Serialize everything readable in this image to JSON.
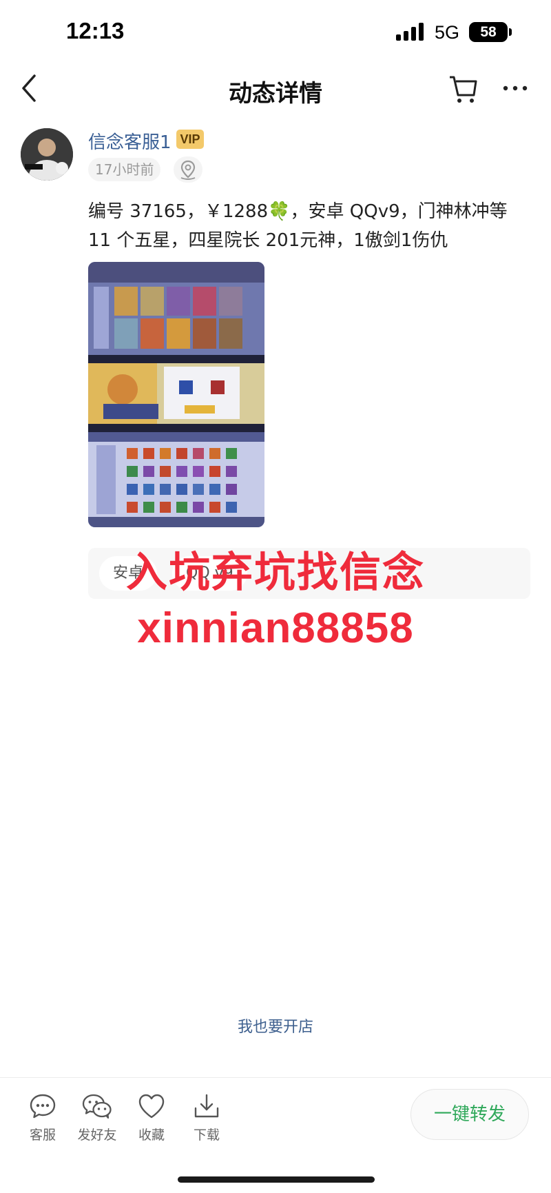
{
  "status_bar": {
    "time": "12:13",
    "network": "5G",
    "battery": "58"
  },
  "nav": {
    "title": "动态详情"
  },
  "post": {
    "author": "信念客服1",
    "badge": "VIP",
    "time": "17小时前",
    "text": "编号 37165，￥1288🍀，安卓 QQv9，门神林冲等 11 个五星，四星院长 201元神，1傲剑1伤仇"
  },
  "tags": [
    "安卓",
    "QQ v9"
  ],
  "overlay": {
    "line1": "入坑弃坑找信念",
    "line2": "xinnian88858"
  },
  "open_shop": "我也要开店",
  "bottom_bar": {
    "items": [
      {
        "label": "客服",
        "icon": "chat-bubble-icon"
      },
      {
        "label": "发好友",
        "icon": "wechat-icon"
      },
      {
        "label": "收藏",
        "icon": "heart-icon"
      },
      {
        "label": "下载",
        "icon": "download-icon"
      }
    ],
    "forward": "一键转发"
  },
  "colors": {
    "accent_green": "#2fa85a",
    "name_blue": "#3a5f95",
    "overlay_red": "#ef2b3b",
    "vip_gold": "#f3c96a"
  }
}
